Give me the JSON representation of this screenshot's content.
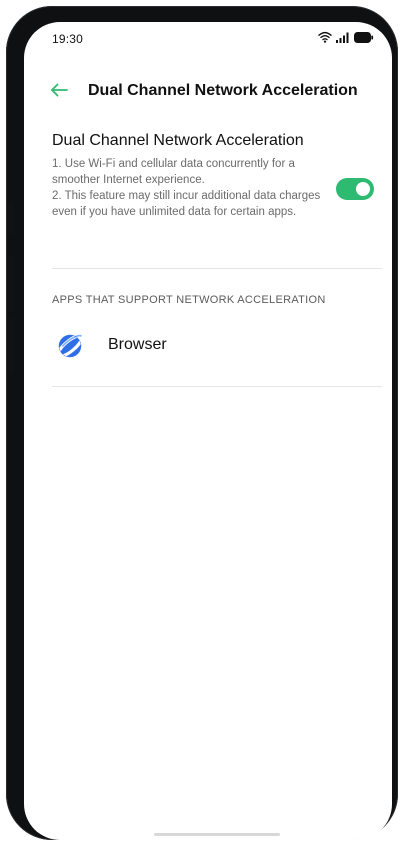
{
  "status_bar": {
    "time": "19:30",
    "icons": [
      "wifi-icon",
      "signal-icon",
      "battery-icon"
    ]
  },
  "app_bar": {
    "back_icon": "back-arrow-icon",
    "title": "Dual Channel Network Acceleration"
  },
  "toggle_setting": {
    "title": "Dual Channel Network Acceleration",
    "description": [
      "1. Use Wi-Fi and cellular data concurrently for a smoother Internet experience.",
      "2. This feature may still incur additional data charges even if you have unlimited data for certain apps."
    ],
    "enabled": true
  },
  "apps_section": {
    "header": "APPS THAT SUPPORT NETWORK ACCELERATION",
    "apps": [
      {
        "label": "Browser",
        "icon": "browser-planet-icon"
      }
    ]
  },
  "colors": {
    "accent": "#2fba71",
    "back_arrow": "#2fba71",
    "browser_icon": "#2f6fe6"
  }
}
